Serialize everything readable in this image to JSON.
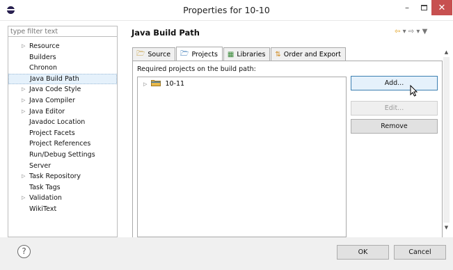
{
  "window": {
    "title": "Properties for 10-10",
    "minimize_glyph": "–",
    "close_glyph": "✕"
  },
  "filter": {
    "placeholder": "type filter text"
  },
  "tree": {
    "items": [
      {
        "label": "Resource",
        "expandable": true
      },
      {
        "label": "Builders",
        "expandable": false
      },
      {
        "label": "Chronon",
        "expandable": false
      },
      {
        "label": "Java Build Path",
        "expandable": false,
        "selected": true
      },
      {
        "label": "Java Code Style",
        "expandable": true
      },
      {
        "label": "Java Compiler",
        "expandable": true
      },
      {
        "label": "Java Editor",
        "expandable": true
      },
      {
        "label": "Javadoc Location",
        "expandable": false
      },
      {
        "label": "Project Facets",
        "expandable": false
      },
      {
        "label": "Project References",
        "expandable": false
      },
      {
        "label": "Run/Debug Settings",
        "expandable": false
      },
      {
        "label": "Server",
        "expandable": false
      },
      {
        "label": "Task Repository",
        "expandable": true
      },
      {
        "label": "Task Tags",
        "expandable": false
      },
      {
        "label": "Validation",
        "expandable": true
      },
      {
        "label": "WikiText",
        "expandable": false
      }
    ]
  },
  "page": {
    "title": "Java Build Path",
    "nav": {
      "back_icon": "back-arrow-icon",
      "forward_icon": "forward-arrow-icon"
    },
    "tabs": [
      {
        "label": "Source",
        "icon": "source-folder-icon",
        "active": false
      },
      {
        "label": "Projects",
        "icon": "project-folder-icon",
        "active": true
      },
      {
        "label": "Libraries",
        "icon": "libraries-icon",
        "active": false
      },
      {
        "label": "Order and Export",
        "icon": "order-export-icon",
        "active": false
      }
    ],
    "required_label": "Required projects on the build path:",
    "projects": [
      {
        "label": "10-11"
      }
    ],
    "buttons": {
      "add": "Add...",
      "edit": "Edit...",
      "remove": "Remove"
    }
  },
  "footer": {
    "help": "?",
    "ok": "OK",
    "cancel": "Cancel"
  },
  "colors": {
    "accent": "#3c7fb1",
    "close_button": "#c75050",
    "selection": "#e5f1fb",
    "folder": "#e8b84a"
  }
}
